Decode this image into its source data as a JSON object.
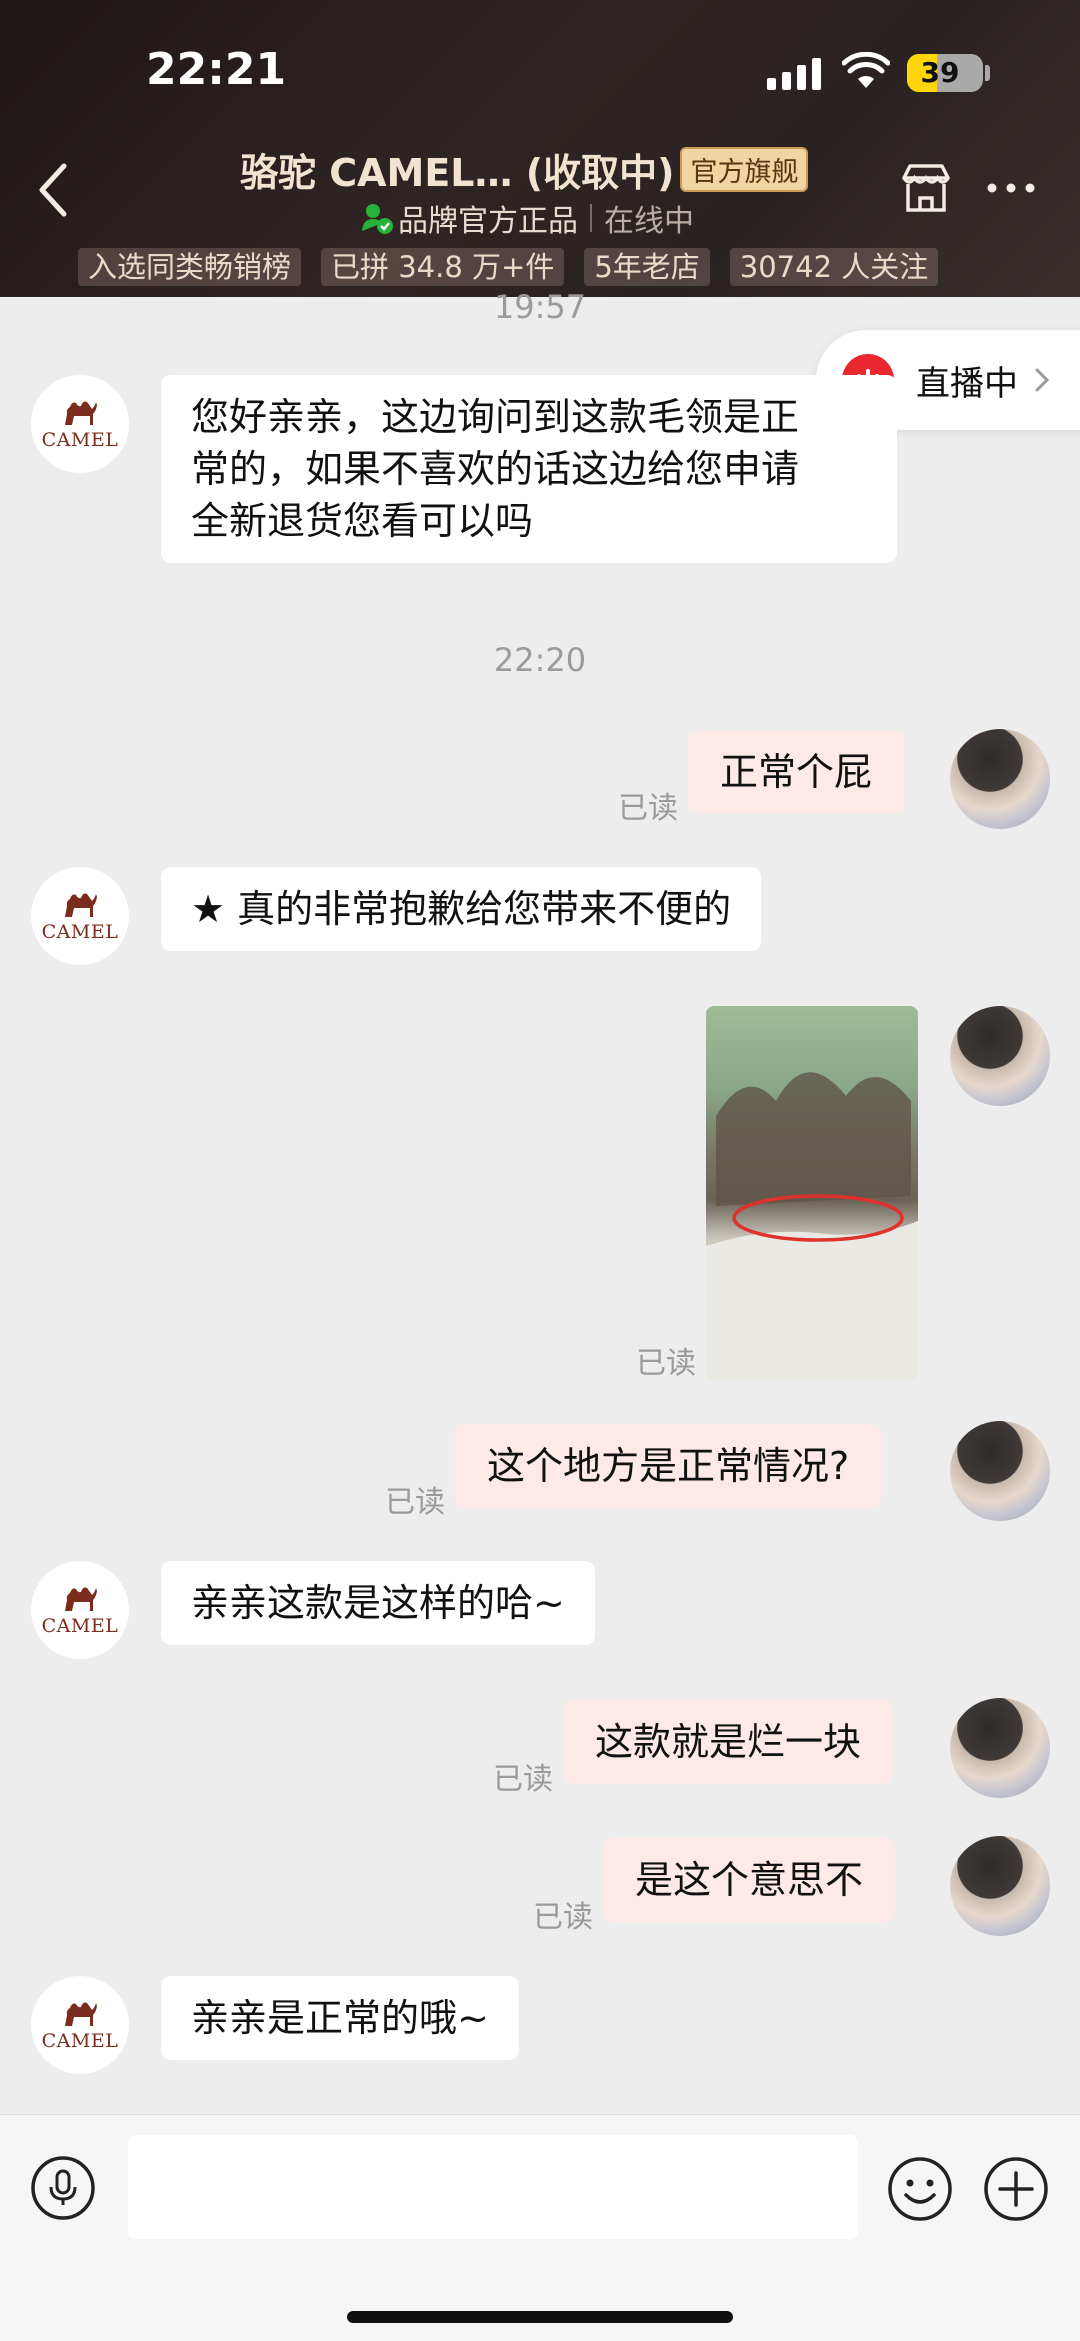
{
  "status_bar": {
    "time": "22:21",
    "battery": "39",
    "battery_level": 0.39
  },
  "header": {
    "title": "骆驼 CAMEL… (收取中)",
    "flagship_badge": "官方旗舰",
    "verified_label": "品牌官方正品",
    "online_status": "在线中",
    "tags": [
      "入选同类畅销榜",
      "已拼 34.8 万+件",
      "5年老店",
      "30742 人关注"
    ]
  },
  "live": {
    "label": "直播中"
  },
  "avatar": {
    "brand": "CAMEL"
  },
  "chat": {
    "partial_time": "19:57",
    "time_divider": "22:20",
    "read_label": "已读",
    "messages": [
      {
        "from": "shop",
        "text": "您好亲亲，这边询问到这款毛领是正\n常的，如果不喜欢的话这边给您申请\n全新退货您看可以吗"
      },
      {
        "from": "user",
        "text": "正常个屁",
        "read": "已读"
      },
      {
        "from": "shop",
        "text": "★ 真的非常抱歉给您带来不便的"
      },
      {
        "from": "user",
        "type": "image",
        "read": "已读"
      },
      {
        "from": "user",
        "text": "这个地方是正常情况?",
        "read": "已读"
      },
      {
        "from": "shop",
        "text": "亲亲这款是这样的哈~"
      },
      {
        "from": "user",
        "text": "这款就是烂一块",
        "read": "已读"
      },
      {
        "from": "user",
        "text": "是这个意思不",
        "read": "已读"
      },
      {
        "from": "shop",
        "text": "亲亲是正常的哦~"
      }
    ]
  },
  "input": {
    "value": "",
    "placeholder": ""
  },
  "colors": {
    "header_bg": "#2a2221",
    "user_bubble": "#fde9e8",
    "live_red": "#e8272f",
    "verified_green": "#27b23b"
  }
}
